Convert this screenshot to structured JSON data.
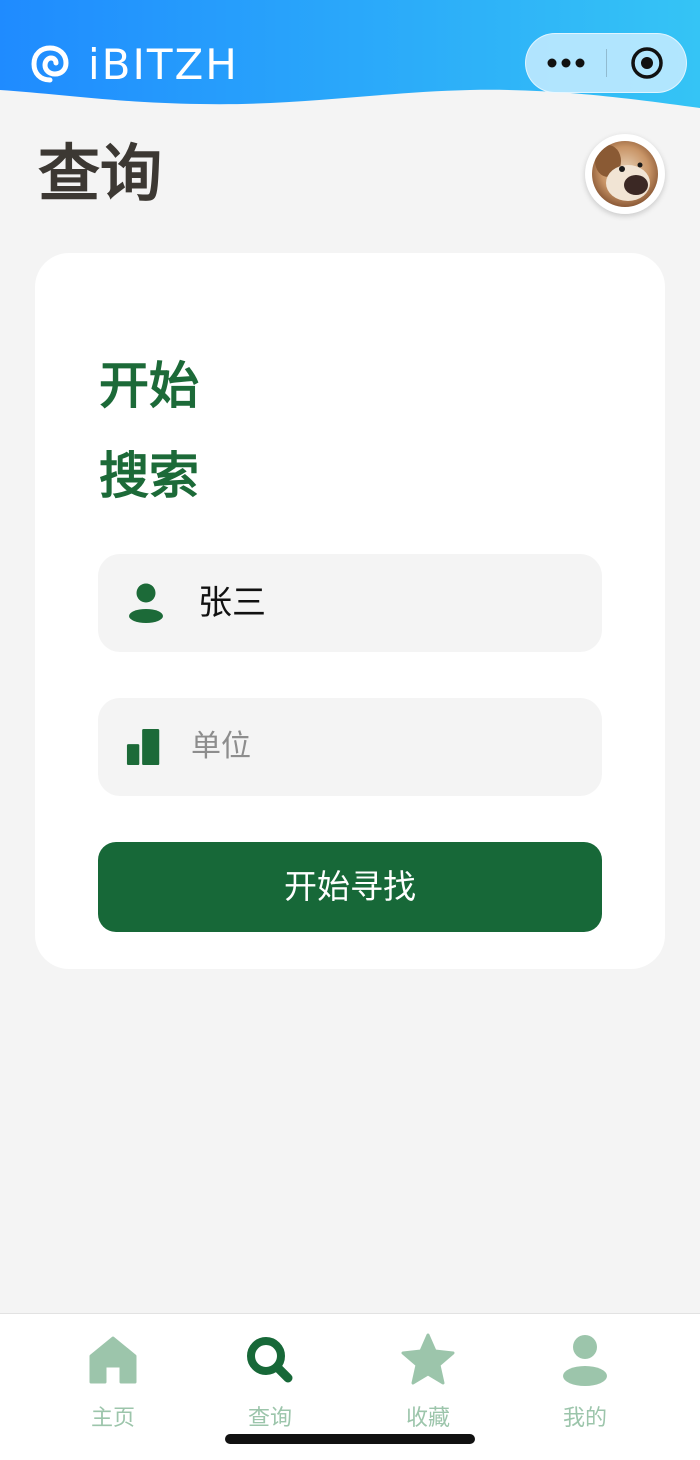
{
  "header": {
    "app_name": "iBITZH",
    "logo_icon": "spiral-logo-icon",
    "more_icon": "more-dots-icon",
    "close_icon": "target-circle-icon"
  },
  "page": {
    "title": "查询",
    "avatar": "dog-avatar"
  },
  "card": {
    "heading_line1": "开始",
    "heading_line2": "搜索",
    "name_field": {
      "icon": "person-icon",
      "value": "张三"
    },
    "org_field": {
      "icon": "bar-chart-icon",
      "placeholder": "单位"
    },
    "submit_label": "开始寻找"
  },
  "tabbar": {
    "items": [
      {
        "label": "主页",
        "icon": "home-icon"
      },
      {
        "label": "查询",
        "icon": "search-icon",
        "active": true
      },
      {
        "label": "收藏",
        "icon": "star-icon"
      },
      {
        "label": "我的",
        "icon": "user-icon"
      }
    ]
  },
  "colors": {
    "header_gradient_start": "#1f8bff",
    "header_gradient_end": "#35c4f5",
    "primary_green": "#176838",
    "inactive_tab": "#9cc5ab",
    "page_background": "#f4f4f4"
  }
}
